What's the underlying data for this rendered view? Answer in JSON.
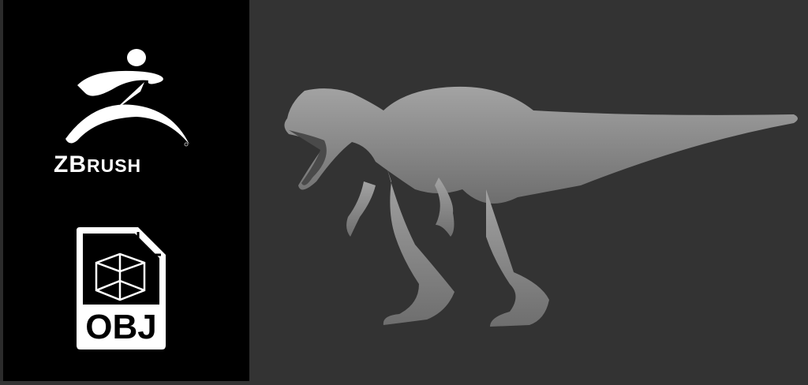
{
  "brand": {
    "logo_text": "ZBrush",
    "z_letter": "Z",
    "b_letter": "B",
    "rest": "RUSH"
  },
  "file_icon": {
    "label": "OBJ"
  },
  "colors": {
    "left_panel": "#000000",
    "viewport": "#333333",
    "model": "#8c8c8c"
  }
}
